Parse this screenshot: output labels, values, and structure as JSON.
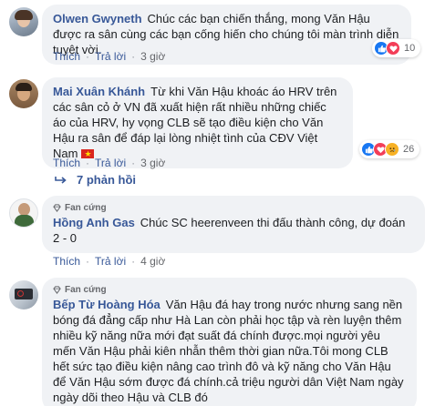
{
  "comments": [
    {
      "author": "Olwen Gwyneth",
      "text": "Chúc các bạn chiến thắng, mong Văn Hậu được ra sân cùng các bạn cống hiến cho chúng tôi màn trình diễn tuyệt vời.",
      "like_label": "Thích",
      "reply_label": "Trả lời",
      "time": "3 giờ",
      "reaction_count": "10",
      "reaction_icons": [
        "like-icon",
        "love-icon"
      ]
    },
    {
      "author": "Mai Xuân Khánh",
      "text": "Từ khi Văn Hậu khoác áo HRV trên các sân cỏ ở VN đã xuất hiện rất nhiều những chiếc áo của HRV, hy vọng CLB sẽ tạo điều kiện cho Văn Hậu ra sân để đáp lại lòng nhiệt tình của CĐV Việt Nam",
      "like_label": "Thích",
      "reply_label": "Trả lời",
      "time": "3 giờ",
      "reaction_count": "26",
      "reaction_icons": [
        "like-icon",
        "love-icon",
        "sad-icon"
      ],
      "replies_label": "7 phản hồi"
    },
    {
      "badge": "Fan cứng",
      "author": "Hồng Anh Gas",
      "text": "Chúc SC heerenveen thi đấu thành công, dự đoán 2 - 0",
      "like_label": "Thích",
      "reply_label": "Trả lời",
      "time": "4 giờ"
    },
    {
      "badge": "Fan cứng",
      "author": "Bếp Từ Hoàng Hóa",
      "text": "Văn Hậu đá hay trong nước nhưng sang nền bóng đá đẳng cấp như Hà Lan còn phải học tập và rèn luyện thêm nhiều kỹ năng nữa mới đạt suất đá chính được.mọi người yêu mến Văn Hậu phải kiên nhẫn thêm thời gian nữa.Tôi mong CLB hết sức tạo điều kiện nâng cao trình đô và kỹ năng cho Văn Hậu để Văn Hậu sớm được đá chính.cả triệu người dân Việt Nam ngày ngày dõi theo Hậu và CLB đó"
    }
  ],
  "colors": {
    "name": "#385898",
    "bubble": "#f0f2f5",
    "like": "#1877f2",
    "love": "#f33e58",
    "sad": "#f7b125"
  }
}
